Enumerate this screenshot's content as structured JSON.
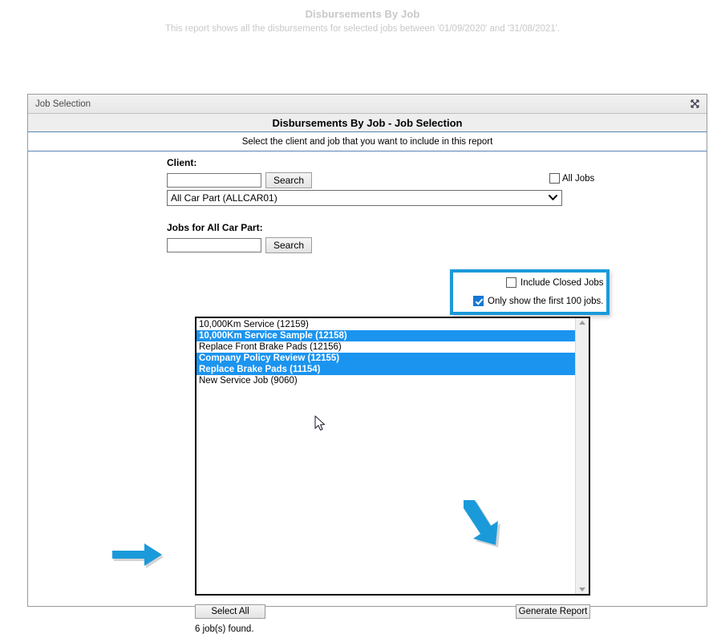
{
  "report": {
    "title": "Disbursements By Job",
    "subtitle": "This report shows all the disbursements for selected jobs between '01/09/2020' and '31/08/2021'."
  },
  "dialog": {
    "titlebar": "Job Selection",
    "close_icon": "close-icon",
    "banner": "Disbursements By Job - Job Selection",
    "instruction": "Select the client and job that you want to include in this report"
  },
  "client": {
    "label": "Client:",
    "search_value": "",
    "search_placeholder": "",
    "search_button": "Search",
    "all_jobs_label": "All Jobs",
    "all_jobs_checked": false,
    "dropdown_value": "All Car Part (ALLCAR01)",
    "dropdown_icon": "chevron-down-icon"
  },
  "jobs": {
    "label": "Jobs for All Car Part:",
    "search_value": "",
    "search_placeholder": "",
    "search_button": "Search",
    "options": {
      "include_closed_label": "Include Closed Jobs",
      "include_closed_checked": false,
      "first_100_label": "Only show the first 100 jobs.",
      "first_100_checked": true
    },
    "list": [
      {
        "label": "10,000Km Service (12159)",
        "selected": false
      },
      {
        "label": "10,000Km Service Sample (12158)",
        "selected": true
      },
      {
        "label": "Replace Front Brake Pads (12156)",
        "selected": false
      },
      {
        "label": "Company Policy Review (12155)",
        "selected": true
      },
      {
        "label": "Replace Brake Pads (11154)",
        "selected": true
      },
      {
        "label": "New Service Job (9060)",
        "selected": false
      }
    ],
    "select_all_button": "Select All",
    "generate_report_button": "Generate Report",
    "jobs_found": "6 job(s) found."
  },
  "annotations": {
    "highlight_color": "#1b9ada",
    "arrow_color": "#1b9ada",
    "arrow_select_all": "arrow-right-icon",
    "arrow_generate_report": "arrow-down-right-icon"
  },
  "cursor": {
    "icon": "mouse-pointer-icon"
  }
}
